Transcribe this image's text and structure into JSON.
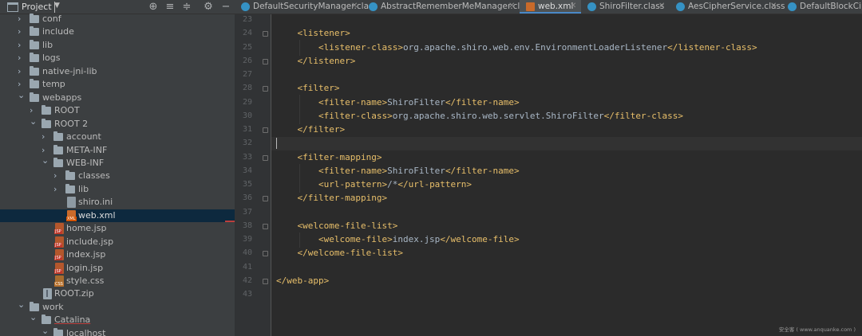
{
  "project_panel": {
    "title": "Project",
    "tools": [
      "crosshair-icon",
      "expand-all-icon",
      "collapse-all-icon",
      "gear-icon",
      "hide-icon"
    ],
    "tree": [
      {
        "label": "conf",
        "type": "folder",
        "depth": 1,
        "expanded": false
      },
      {
        "label": "include",
        "type": "folder",
        "depth": 1,
        "expanded": false
      },
      {
        "label": "lib",
        "type": "folder",
        "depth": 1,
        "expanded": false
      },
      {
        "label": "logs",
        "type": "folder",
        "depth": 1,
        "expanded": false
      },
      {
        "label": "native-jni-lib",
        "type": "folder",
        "depth": 1,
        "expanded": false
      },
      {
        "label": "temp",
        "type": "folder",
        "depth": 1,
        "expanded": false
      },
      {
        "label": "webapps",
        "type": "folder",
        "depth": 1,
        "expanded": true
      },
      {
        "label": "ROOT",
        "type": "folder",
        "depth": 2,
        "expanded": false
      },
      {
        "label": "ROOT 2",
        "type": "folder",
        "depth": 2,
        "expanded": true
      },
      {
        "label": "account",
        "type": "folder",
        "depth": 3,
        "expanded": false
      },
      {
        "label": "META-INF",
        "type": "folder",
        "depth": 3,
        "expanded": false
      },
      {
        "label": "WEB-INF",
        "type": "folder",
        "depth": 3,
        "expanded": true
      },
      {
        "label": "classes",
        "type": "folder",
        "depth": 4,
        "expanded": false
      },
      {
        "label": "lib",
        "type": "folder",
        "depth": 4,
        "expanded": false
      },
      {
        "label": "shiro.ini",
        "type": "ini",
        "depth": 4
      },
      {
        "label": "web.xml",
        "type": "xml",
        "depth": 4,
        "selected": true
      },
      {
        "label": "home.jsp",
        "type": "jsp",
        "depth": 3
      },
      {
        "label": "include.jsp",
        "type": "jsp",
        "depth": 3
      },
      {
        "label": "index.jsp",
        "type": "jsp",
        "depth": 3
      },
      {
        "label": "login.jsp",
        "type": "jsp",
        "depth": 3
      },
      {
        "label": "style.css",
        "type": "css",
        "depth": 3
      },
      {
        "label": "ROOT.zip",
        "type": "zip",
        "depth": 2
      },
      {
        "label": "work",
        "type": "folder",
        "depth": 1,
        "expanded": true
      },
      {
        "label": "Catalina",
        "type": "folder",
        "depth": 2,
        "expanded": true,
        "underlined": true
      },
      {
        "label": "localhost",
        "type": "folder",
        "depth": 3,
        "expanded": true
      }
    ]
  },
  "tabs": [
    {
      "label": "DefaultSecurityManager.class",
      "icon": "class-icon",
      "active": false
    },
    {
      "label": "AbstractRememberMeManager.class",
      "icon": "class-icon",
      "active": false
    },
    {
      "label": "web.xml",
      "icon": "xml-file-icon",
      "active": true
    },
    {
      "label": "ShiroFilter.class",
      "icon": "class-icon",
      "active": false
    },
    {
      "label": "AesCipherService.class",
      "icon": "class-icon",
      "active": false
    },
    {
      "label": "DefaultBlockCiphe",
      "icon": "class-icon",
      "active": false
    }
  ],
  "editor": {
    "current_line": "32",
    "lines": [
      {
        "n": "23",
        "parts": []
      },
      {
        "n": "24",
        "parts": [
          {
            "t": "    "
          },
          {
            "tag": "<listener>"
          }
        ]
      },
      {
        "n": "25",
        "parts": [
          {
            "t": "        "
          },
          {
            "tag": "<listener-class>"
          },
          {
            "t": "org.apache.shiro.web.env.EnvironmentLoaderListener"
          },
          {
            "tag": "</listener-class>"
          }
        ]
      },
      {
        "n": "26",
        "parts": [
          {
            "t": "    "
          },
          {
            "tag": "</listener>"
          }
        ]
      },
      {
        "n": "27",
        "parts": []
      },
      {
        "n": "28",
        "parts": [
          {
            "t": "    "
          },
          {
            "tag": "<filter>"
          }
        ]
      },
      {
        "n": "29",
        "parts": [
          {
            "t": "        "
          },
          {
            "tag": "<filter-name>"
          },
          {
            "t": "ShiroFilter"
          },
          {
            "tag": "</filter-name>"
          }
        ]
      },
      {
        "n": "30",
        "parts": [
          {
            "t": "        "
          },
          {
            "tag": "<filter-class>"
          },
          {
            "t": "org.apache.shiro.web.servlet.ShiroFilter"
          },
          {
            "tag": "</filter-class>"
          }
        ]
      },
      {
        "n": "31",
        "parts": [
          {
            "t": "    "
          },
          {
            "tag": "</filter>"
          }
        ]
      },
      {
        "n": "32",
        "parts": []
      },
      {
        "n": "33",
        "parts": [
          {
            "t": "    "
          },
          {
            "tag": "<filter-mapping>"
          }
        ]
      },
      {
        "n": "34",
        "parts": [
          {
            "t": "        "
          },
          {
            "tag": "<filter-name>"
          },
          {
            "t": "ShiroFilter"
          },
          {
            "tag": "</filter-name>"
          }
        ]
      },
      {
        "n": "35",
        "parts": [
          {
            "t": "        "
          },
          {
            "tag": "<url-pattern>"
          },
          {
            "t": "/*"
          },
          {
            "tag": "</url-pattern>"
          }
        ]
      },
      {
        "n": "36",
        "parts": [
          {
            "t": "    "
          },
          {
            "tag": "</filter-mapping>"
          }
        ]
      },
      {
        "n": "37",
        "parts": []
      },
      {
        "n": "38",
        "parts": [
          {
            "t": "    "
          },
          {
            "tag": "<welcome-file-list>"
          }
        ]
      },
      {
        "n": "39",
        "parts": [
          {
            "t": "        "
          },
          {
            "tag": "<welcome-file>"
          },
          {
            "t": "index.jsp"
          },
          {
            "tag": "</welcome-file>"
          }
        ]
      },
      {
        "n": "40",
        "parts": [
          {
            "t": "    "
          },
          {
            "tag": "</welcome-file-list>"
          }
        ]
      },
      {
        "n": "41",
        "parts": []
      },
      {
        "n": "42",
        "parts": [
          {
            "tag": "</web-app>"
          }
        ]
      },
      {
        "n": "43",
        "parts": []
      }
    ]
  },
  "watermark": "安全客 ( www.anquanke.com )",
  "colors": {
    "background": "#2b2b2b",
    "panel": "#3c3f41",
    "tag": "#e8bf6a",
    "text": "#a9b7c6",
    "selection": "#0d293e",
    "active_tab_underline": "#4a88c7"
  }
}
